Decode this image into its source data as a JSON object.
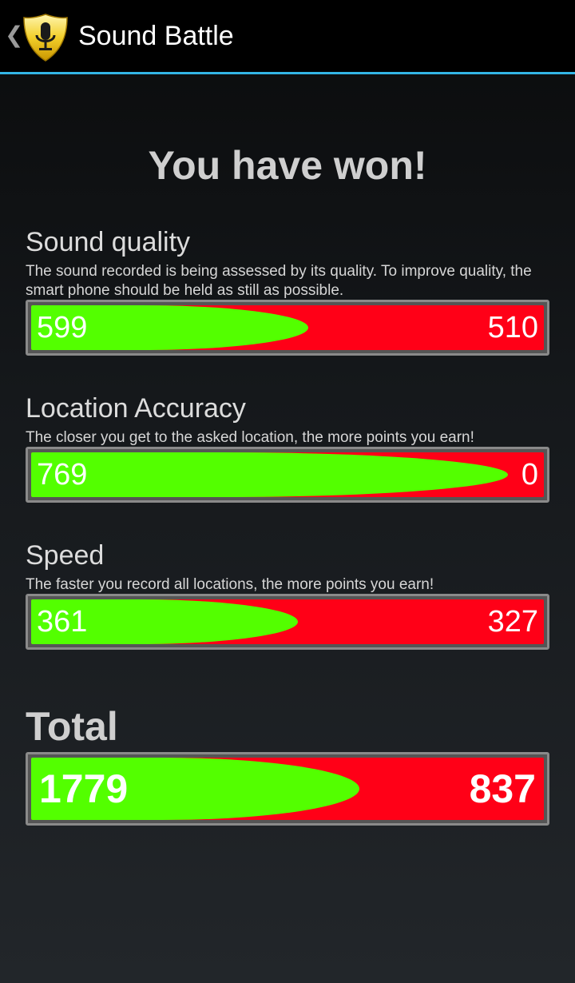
{
  "header": {
    "title": "Sound Battle",
    "up_icon": "chevron-left-icon",
    "app_icon": "microphone-shield-icon"
  },
  "headline": "You have won!",
  "sections": [
    {
      "title": "Sound quality",
      "description": "The sound recorded is being assessed by its quality. To improve quality, the smart phone should be held as still as possible.",
      "player_score": "599",
      "opponent_score": "510",
      "player_fraction": 0.54
    },
    {
      "title": "Location Accuracy",
      "description": "The closer you get to the asked location, the more points you earn!",
      "player_score": "769",
      "opponent_score": "0",
      "player_fraction": 0.93
    },
    {
      "title": "Speed",
      "description": "The faster you record all locations, the more points you earn!",
      "player_score": "361",
      "opponent_score": "327",
      "player_fraction": 0.52
    }
  ],
  "total": {
    "title": "Total",
    "player_score": "1779",
    "opponent_score": "837",
    "player_fraction": 0.64
  },
  "colors": {
    "player": "#53ff00",
    "opponent": "#ff0017",
    "accent": "#33b5e5"
  }
}
